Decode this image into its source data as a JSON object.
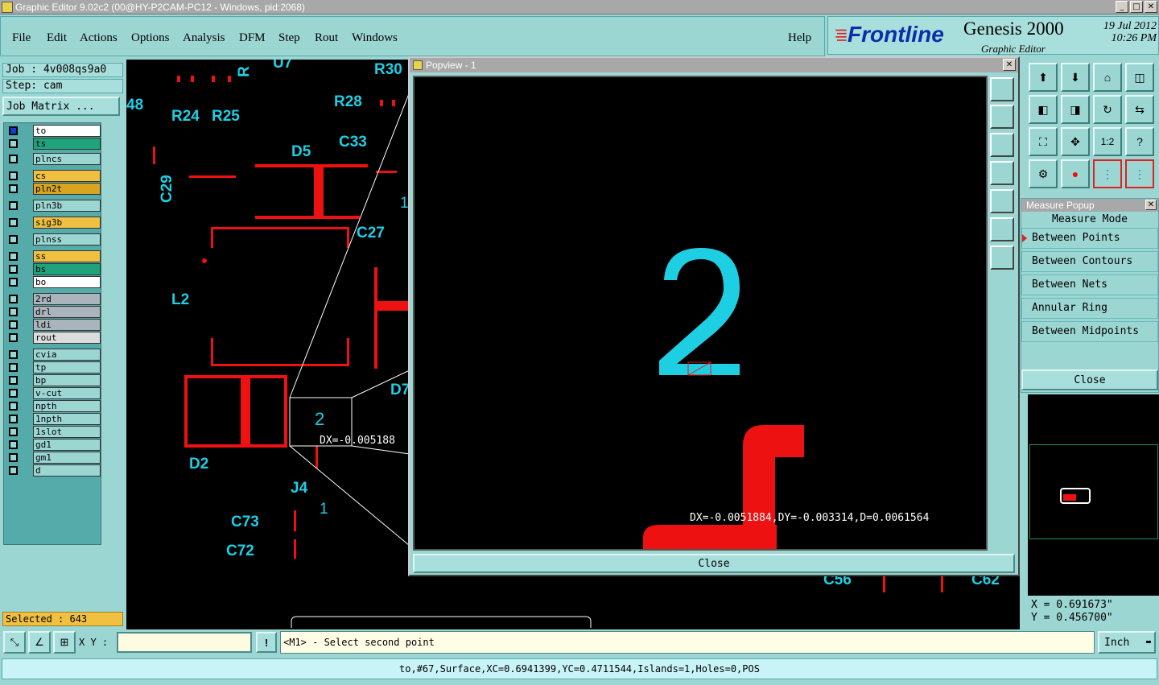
{
  "window": {
    "title": "Graphic Editor 9.02c2 (00@HY-P2CAM-PC12 - Windows, pid:2068)"
  },
  "menu": [
    "File",
    "Edit",
    "Actions",
    "Options",
    "Analysis",
    "DFM",
    "Step",
    "Rout",
    "Windows"
  ],
  "help_label": "Help",
  "brand": {
    "logo": "Frontline",
    "product": "Genesis 2000",
    "subtitle": "Graphic Editor",
    "date": "19 Jul 2012",
    "time": "10:26 PM"
  },
  "job": {
    "job_label": "Job : 4v008qs9a0",
    "step_label": "Step: cam",
    "matrix_button": "Job Matrix ..."
  },
  "layers": [
    {
      "name": "to",
      "color": "#ffffff"
    },
    {
      "name": "ts",
      "color": "#1fa37a"
    },
    {
      "name": "plncs",
      "color": "#9cd6d3"
    },
    {
      "name": "cs",
      "color": "#f0c040"
    },
    {
      "name": "pln2t",
      "color": "#d9a520"
    },
    {
      "name": "pln3b",
      "color": "#9cd6d3"
    },
    {
      "name": "sig3b",
      "color": "#f0c040"
    },
    {
      "name": "plnss",
      "color": "#9cd6d3"
    },
    {
      "name": "ss",
      "color": "#f0c040"
    },
    {
      "name": "bs",
      "color": "#1fa37a"
    },
    {
      "name": "bo",
      "color": "#ffffff"
    },
    {
      "name": "2rd",
      "color": "#a9b4bc"
    },
    {
      "name": "drl",
      "color": "#a9b4bc"
    },
    {
      "name": "ldi",
      "color": "#a9b4bc"
    },
    {
      "name": "rout",
      "color": "#dcdcdc"
    },
    {
      "name": "cvia",
      "color": "#9cd6d3"
    },
    {
      "name": "tp",
      "color": "#9cd6d3"
    },
    {
      "name": "bp",
      "color": "#9cd6d3"
    },
    {
      "name": "v-cut",
      "color": "#9cd6d3"
    },
    {
      "name": "npth",
      "color": "#9cd6d3"
    },
    {
      "name": "1npth",
      "color": "#9cd6d3"
    },
    {
      "name": "1slot",
      "color": "#9cd6d3"
    },
    {
      "name": "gd1",
      "color": "#9cd6d3"
    },
    {
      "name": "gm1",
      "color": "#9cd6d3"
    },
    {
      "name": "d",
      "color": "#9cd6d3"
    }
  ],
  "selected": "Selected : 643",
  "canvas_labels": [
    "48",
    "R24",
    "R25",
    "R28",
    "R30",
    "U7",
    "R",
    "D5",
    "C33",
    "C29",
    "C27",
    "L2",
    "D2",
    "J4",
    "C73",
    "C72",
    "1",
    "D7",
    "1",
    "C56",
    "C62"
  ],
  "measure_readout": "DX=-0.005188",
  "popview": {
    "title": "Popview - 1",
    "digit": "2",
    "readout": "DX=-0.0051884,DY=-0.003314,D=0.0061564",
    "close": "Close"
  },
  "measure_popup": {
    "title": "Measure Popup",
    "mode_label": "Measure Mode",
    "options": [
      "Between Points",
      "Between Contours",
      "Between Nets",
      "Annular Ring",
      "Between Midpoints"
    ],
    "close": "Close"
  },
  "coords": {
    "x": "X = 0.691673\"",
    "y": "Y = 0.456700\""
  },
  "bottom": {
    "xy_label": "X Y :",
    "xy_value": "",
    "prompt": "<M1> - Select second point",
    "units": "Inch"
  },
  "status": "to,#67,Surface,XC=0.6941399,YC=0.4711544,Islands=1,Holes=0,POS",
  "colors": {
    "panel": "#9cd6d3",
    "cyan": "#1ecfe4",
    "red": "#ee1111",
    "brand": "#0b2fa8"
  }
}
